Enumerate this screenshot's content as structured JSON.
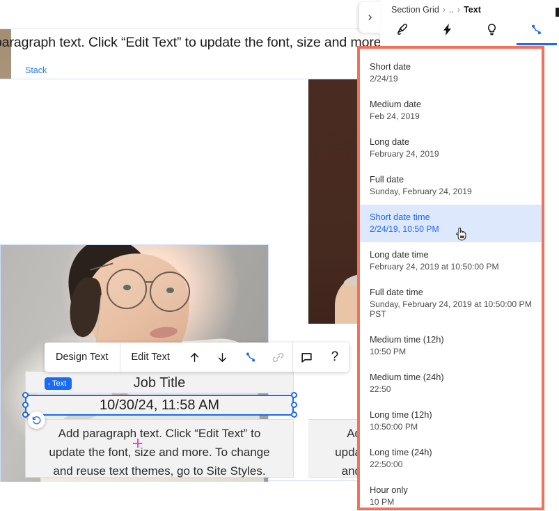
{
  "canvas": {
    "top_paragraph": "paragraph text. Click “Edit Text” to update the font, size and more.",
    "stack_label": "Stack",
    "job_title": "Job Title",
    "selected_datetime": "10/30/24, 11:58 AM",
    "paragraph": "Add paragraph text. Click “Edit Text” to update the font, size and more. To change and reuse text themes, go to Site Styles.",
    "paragraph_clipped": "Ad\nupda\nand",
    "element_badge": "Text",
    "badge_chevron": "‹",
    "focal_point_icon": "plus-focal-point-icon",
    "refresh_icon": "reset-icon"
  },
  "float_toolbar": {
    "design_text": "Design Text",
    "edit_text": "Edit Text",
    "move_up_icon": "↑",
    "move_down_icon": "↓",
    "data_link_icon": "data-link-icon",
    "link_icon": "link-icon",
    "comment_icon": "comment-icon",
    "help_icon": "?"
  },
  "panel": {
    "expand_chevron": "›",
    "breadcrumb": {
      "root": "Section Grid",
      "ellipsis": "..",
      "current": "Text",
      "separator": "›"
    },
    "tabs": [
      {
        "name": "design-tab",
        "icon": "paintbrush-icon",
        "active": false
      },
      {
        "name": "animation-tab",
        "icon": "lightning-bolt-icon",
        "active": false
      },
      {
        "name": "insights-tab",
        "icon": "lightbulb-icon",
        "active": false
      },
      {
        "name": "data-link-tab",
        "icon": "data-link-icon",
        "active": true
      }
    ]
  },
  "dropdown": {
    "highlight_color": "#f4705a",
    "selected_bg": "#dde8fd",
    "selected_fg": "#1b6bf5",
    "items": [
      {
        "label": "Short date",
        "value": "2/24/19",
        "selected": false
      },
      {
        "label": "Medium date",
        "value": "Feb 24, 2019",
        "selected": false
      },
      {
        "label": "Long date",
        "value": "February 24, 2019",
        "selected": false
      },
      {
        "label": "Full date",
        "value": "Sunday, February 24, 2019",
        "selected": false
      },
      {
        "label": "Short date time",
        "value": "2/24/19, 10:50 PM",
        "selected": true
      },
      {
        "label": "Long date time",
        "value": "February 24, 2019 at 10:50:00 PM",
        "selected": false
      },
      {
        "label": "Full date time",
        "value": "Sunday, February 24, 2019 at 10:50:00 PM PST",
        "selected": false
      },
      {
        "label": "Medium time (12h)",
        "value": "10:50 PM",
        "selected": false
      },
      {
        "label": "Medium time (24h)",
        "value": "22:50",
        "selected": false
      },
      {
        "label": "Long time (12h)",
        "value": "10:50:00 PM",
        "selected": false
      },
      {
        "label": "Long time (24h)",
        "value": "22:50:00",
        "selected": false
      },
      {
        "label": "Hour only",
        "value": "10 PM",
        "selected": false
      }
    ]
  },
  "cursor": {
    "icon": "pointing-hand-cursor"
  }
}
